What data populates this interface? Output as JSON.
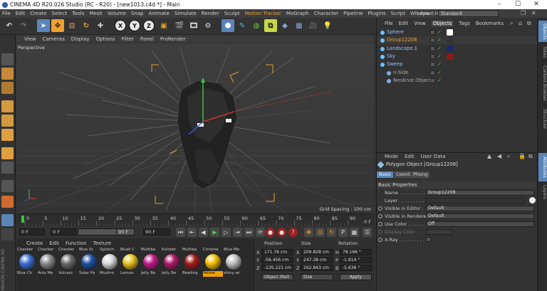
{
  "window": {
    "title": "CINEMA 4D R20.026 Studio (RC - R20) - [new1013.c4d *] - Main"
  },
  "menu": [
    "File",
    "Edit",
    "Create",
    "Select",
    "Tools",
    "Mesh",
    "Volume",
    "Snap",
    "Animate",
    "Simulate",
    "Render",
    "Sculpt",
    "Motion Tracker",
    "MoGraph",
    "Character",
    "Pipeline",
    "Plugins",
    "Script",
    "Window",
    "Help"
  ],
  "layout": {
    "label": "Layout:",
    "value": "Standard"
  },
  "toolbar": {
    "x": "X",
    "y": "Y",
    "z": "Z"
  },
  "viewport": {
    "menu": [
      "View",
      "Cameras",
      "Display",
      "Options",
      "Filter",
      "Panel",
      "ProRender"
    ],
    "label": "Perspective",
    "grid_spacing": "Grid Spacing : 100 cm"
  },
  "timeline": {
    "ticks": [
      "0",
      "5",
      "10",
      "15",
      "20",
      "25",
      "30",
      "35",
      "40",
      "45",
      "50",
      "55",
      "60",
      "65",
      "70",
      "75",
      "80",
      "85",
      "90"
    ],
    "end_label": "0 F",
    "start_field": "0 F",
    "preview_start": "0 F",
    "preview_end": "90 F",
    "end_field": "90 F"
  },
  "materials": {
    "menu": [
      "Create",
      "Edit",
      "Function",
      "Texture"
    ],
    "items": [
      {
        "top": "Checker",
        "label": "Blue Ch",
        "color": "#3b6fd6"
      },
      {
        "top": "Checker",
        "label": "Anis Me",
        "color": "#8a8a8a"
      },
      {
        "top": "Checker",
        "label": "Vulcani",
        "color": "#6a6a6a"
      },
      {
        "top": "Blue St",
        "label": "Solar Pa",
        "color": "#1d4fa3"
      },
      {
        "top": "Splotch",
        "label": "Mushro",
        "color": "#d9d9d9"
      },
      {
        "top": "Bluet C",
        "label": "Lemon",
        "color": "#e8c21a"
      },
      {
        "top": "Multiba",
        "label": "Jelly Be",
        "color": "#c21a8a"
      },
      {
        "top": "Knicker",
        "label": "Jelly Be",
        "color": "#b01a6a"
      },
      {
        "top": "Multiba",
        "label": "Bowling",
        "color": "#a61a1a"
      },
      {
        "top": "Chrome",
        "label": "Yellow",
        "color": "#f0c000"
      },
      {
        "top": "Blue Me",
        "label": "shiny wi",
        "color": "#bfbfbf"
      }
    ],
    "selected_label_color": "#f0a000"
  },
  "coords": {
    "headers": [
      "Position",
      "Size",
      "Rotation"
    ],
    "rows": [
      {
        "axis": "X",
        "pos": "171.76 cm",
        "size_axis": "X",
        "size": "209.828 cm",
        "rot_axis": "H",
        "rot": "78.166 °"
      },
      {
        "axis": "Y",
        "pos": "-56.456 cm",
        "size_axis": "Y",
        "size": "247.38 cm",
        "rot_axis": "P",
        "rot": "-1.914 °"
      },
      {
        "axis": "Z",
        "pos": "-135.221 cm",
        "size_axis": "Z",
        "size": "262.843 cm",
        "rot_axis": "B",
        "rot": "-5.636 °"
      }
    ],
    "mode": "Object (Rel)",
    "size_mode": "Size",
    "apply": "Apply"
  },
  "objects": {
    "tabs": [
      "File",
      "Edit",
      "View",
      "Objects",
      "Tags",
      "Bookmarks"
    ],
    "active_tab": "Objects",
    "items": [
      {
        "name": "Sphere",
        "indent": 0,
        "tag": "#ffffff"
      },
      {
        "name": "Group12208",
        "indent": 0,
        "selected": true,
        "tag": "#333333"
      },
      {
        "name": "Landscape.1",
        "indent": 0,
        "tag": "#1b2a6b"
      },
      {
        "name": "Sky",
        "indent": 0,
        "tag": "#8a1a1a"
      },
      {
        "name": "Sweep",
        "indent": 0,
        "tag": ""
      },
      {
        "name": "n-Side",
        "indent": 1,
        "tag": ""
      },
      {
        "name": "NeoKnot Object",
        "indent": 1,
        "tag": ""
      }
    ]
  },
  "attributes": {
    "menu": [
      "Mode",
      "Edit",
      "User Data"
    ],
    "object_title": "Polygon Object [Group12208]",
    "tabs": [
      "Basic",
      "Coord.",
      "Phong"
    ],
    "section": "Basic Properties",
    "rows": [
      {
        "label": "Name . . . . . . . . . . .",
        "value": "Group12208"
      },
      {
        "label": "Layer . . . . . . . . . . .",
        "value": ""
      },
      {
        "label": "Visible in Editor . .",
        "value": "Default"
      },
      {
        "label": "Visible in Renderer",
        "value": "Default"
      },
      {
        "label": "Use Color . . . . . . .",
        "value": "Off"
      },
      {
        "label": "Display Color . . . .",
        "value": ""
      },
      {
        "label": "X-Ray . . . . . . . . . .",
        "value": ""
      }
    ]
  },
  "side_tabs": [
    "Objects",
    "Takes",
    "Content Browser",
    "Structure",
    "Attributes",
    "Layers"
  ],
  "logo": "MAXON CINEMA 4D"
}
